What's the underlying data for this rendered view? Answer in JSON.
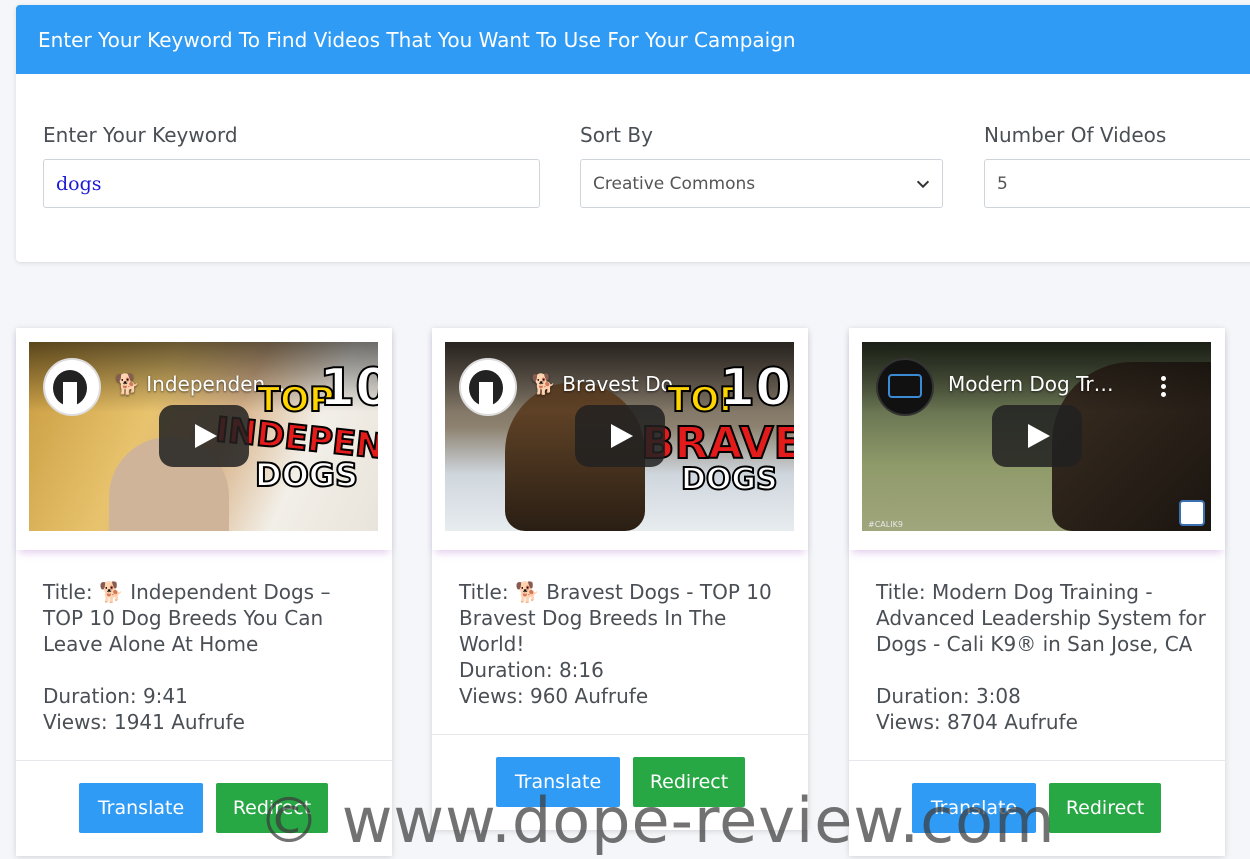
{
  "header": {
    "title": "Enter Your Keyword To Find Videos That You Want To Use For Your Campaign"
  },
  "form": {
    "keyword_label": "Enter Your Keyword",
    "keyword_value": "dogs",
    "sort_label": "Sort By",
    "sort_value": "Creative Commons",
    "count_label": "Number Of Videos",
    "count_value": "5"
  },
  "videos": [
    {
      "thumb_title": "🐕 Independen…",
      "overlay": [
        "TOP",
        "10",
        "INDEPENDENT",
        "DOGS"
      ],
      "title": "Title: 🐕 Independent Dogs – TOP 10 Dog Breeds You Can Leave Alone At Home",
      "duration": "Duration: 9:41",
      "views": "Views: 1941 Aufrufe"
    },
    {
      "thumb_title": "🐕 Bravest Do…",
      "overlay": [
        "TOP",
        "10",
        "BRAVEST",
        "DOGS"
      ],
      "title": "Title: 🐕 Bravest Dogs - TOP 10 Bravest Dog Breeds In The World!",
      "duration": "Duration: 8:16",
      "views": "Views: 960 Aufrufe"
    },
    {
      "thumb_title": "Modern Dog Tr…",
      "overlay": [
        "#CALIK9"
      ],
      "title": "Title: Modern Dog Training - Advanced Leadership System for Dogs - Cali K9® in San Jose, CA",
      "duration": "Duration: 3:08",
      "views": "Views: 8704 Aufrufe"
    }
  ],
  "buttons": {
    "translate": "Translate",
    "redirect": "Redirect"
  },
  "watermark": "© www.dope-review.com",
  "colors": {
    "accent": "#2f9bf5",
    "success": "#28a745"
  }
}
